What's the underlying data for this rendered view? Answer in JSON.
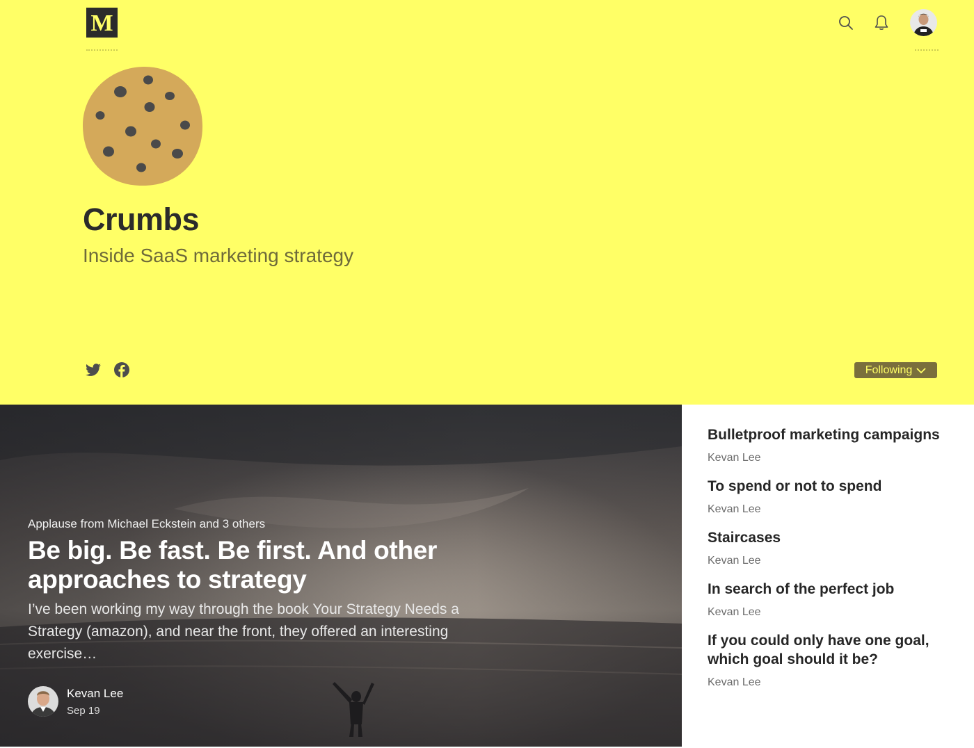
{
  "colors": {
    "hero_background": "#ffff66",
    "logo_background": "#2b2b2b",
    "logo_text": "#ffff66",
    "cookie": "#d4a95a",
    "cookie_chips": "#4a4a4a",
    "following_button_bg": "#7a6f3c",
    "following_button_text": "#ffff66",
    "icon_color": "#4d4d4d"
  },
  "topbar": {
    "logo_text": "M",
    "icons": [
      "search-icon",
      "bell-icon"
    ],
    "avatar": "user-avatar"
  },
  "publication": {
    "title": "Crumbs",
    "tagline": "Inside SaaS marketing strategy",
    "social": [
      "twitter-icon",
      "facebook-icon"
    ],
    "follow_label": "Following"
  },
  "featured": {
    "applause": "Applause from Michael Eckstein and 3 others",
    "title": "Be big. Be fast. Be first. And other approaches to strategy",
    "snippet": "I’ve been working my way through the book Your Strategy Needs a Strategy (amazon), and near the front, they offered an interesting exercise…",
    "author": "Kevan Lee",
    "date": "Sep 19"
  },
  "stories": [
    {
      "title": "Bulletproof marketing campaigns",
      "author": "Kevan Lee"
    },
    {
      "title": "To spend or not to spend",
      "author": "Kevan Lee"
    },
    {
      "title": "Staircases",
      "author": "Kevan Lee"
    },
    {
      "title": "In search of the perfect job",
      "author": "Kevan Lee"
    },
    {
      "title": "If you could only have one goal, which goal should it be?",
      "author": "Kevan Lee"
    }
  ]
}
